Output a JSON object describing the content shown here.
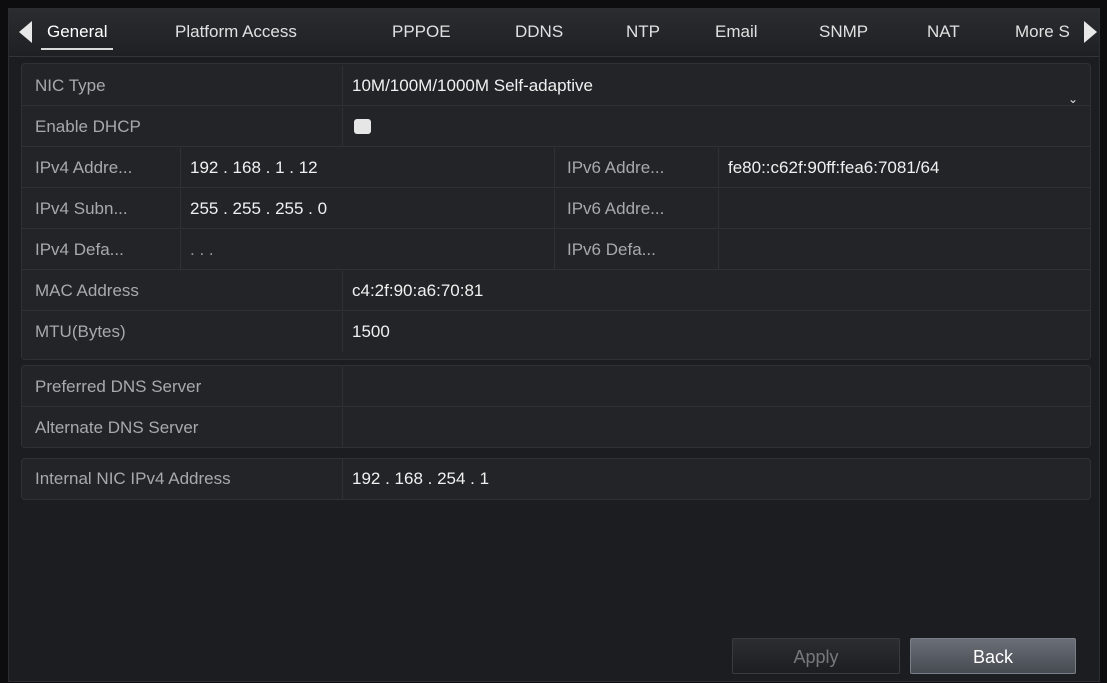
{
  "tabs": {
    "items": [
      "General",
      "Platform Access",
      "PPPOE",
      "DDNS",
      "NTP",
      "Email",
      "SNMP",
      "NAT",
      "More S"
    ],
    "active": "General"
  },
  "nic": {
    "nic_type_label": "NIC Type",
    "nic_type_value": "10M/100M/1000M Self-adaptive",
    "dhcp_label": "Enable DHCP",
    "dhcp_checked": false,
    "ipv4_address_label": "IPv4 Addre...",
    "ipv4_address_value": "192 . 168 . 1     . 12",
    "ipv4_subnet_label": "IPv4 Subn...",
    "ipv4_subnet_value": "255 . 255 . 255 . 0",
    "ipv4_gateway_label": "IPv4 Defa...",
    "ipv4_gateway_value": "     .        .        .",
    "ipv6_address1_label": "IPv6 Addre...",
    "ipv6_address1_value": "fe80::c62f:90ff:fea6:7081/64",
    "ipv6_address2_label": "IPv6 Addre...",
    "ipv6_address2_value": "",
    "ipv6_gateway_label": "IPv6 Defa...",
    "ipv6_gateway_value": "",
    "mac_label": "MAC Address",
    "mac_value": "c4:2f:90:a6:70:81",
    "mtu_label": "MTU(Bytes)",
    "mtu_value": "1500"
  },
  "dns": {
    "preferred_label": "Preferred DNS Server",
    "preferred_value": "",
    "alternate_label": "Alternate DNS Server",
    "alternate_value": ""
  },
  "internal": {
    "label": "Internal NIC IPv4 Address",
    "value": "192 . 168 . 254 . 1"
  },
  "buttons": {
    "apply": "Apply",
    "back": "Back"
  },
  "icons": {
    "tab_scroll_left": "triangle-left-icon",
    "tab_scroll_right": "triangle-right-icon",
    "dropdown": "chevron-down-icon"
  }
}
